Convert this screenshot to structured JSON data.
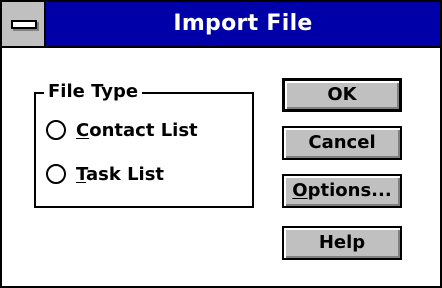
{
  "window": {
    "title": "Import File",
    "system_menu_icon": "system-menu-icon"
  },
  "file_type_group": {
    "label": "File Type",
    "options": [
      {
        "mnemonic": "C",
        "rest": "ontact List",
        "selected": false
      },
      {
        "mnemonic": "T",
        "rest": "ask List",
        "selected": false
      }
    ]
  },
  "buttons": {
    "ok": {
      "label": "OK"
    },
    "cancel": {
      "label": "Cancel"
    },
    "options": {
      "mnemonic": "O",
      "rest": "ptions..."
    },
    "help": {
      "label": "Help"
    }
  },
  "colors": {
    "title_bar": "#0000a8",
    "button_face": "#c0c0c0",
    "client_background": "#ffffff"
  }
}
